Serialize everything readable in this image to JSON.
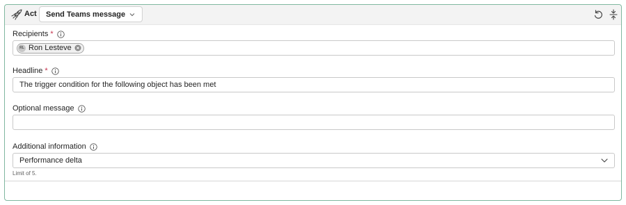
{
  "header": {
    "act_label": "Act",
    "action_value": "Send Teams message",
    "icons": {
      "act": "rocket-icon",
      "chevron": "chevron-down-icon",
      "undo": "undo-icon",
      "collapse": "collapse-icon"
    }
  },
  "recipients": {
    "label": "Recipients",
    "required_mark": "*",
    "chips": [
      {
        "initials": "RL",
        "name": "Ron Lesteve"
      }
    ]
  },
  "headline": {
    "label": "Headline",
    "required_mark": "*",
    "value": "The trigger condition for the following object has been met"
  },
  "optional_message": {
    "label": "Optional message",
    "value": ""
  },
  "additional_information": {
    "label": "Additional information",
    "selected": "Performance delta",
    "helper": "Limit of 5."
  },
  "colors": {
    "card_border": "#7fb79f",
    "required": "#c4314b",
    "header_bg": "#f3f3f3"
  }
}
